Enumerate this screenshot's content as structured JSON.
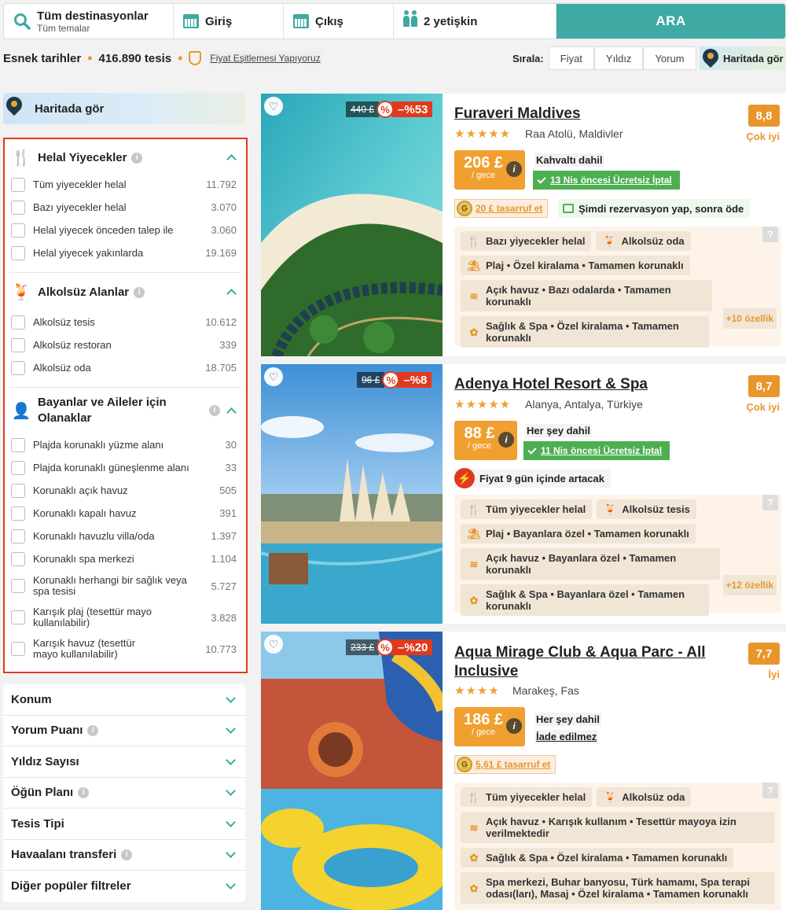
{
  "search": {
    "destination": "Tüm destinasyonlar",
    "theme": "Tüm temalar",
    "checkin": "Giriş",
    "checkout": "Çıkış",
    "guests": "2 yetişkin",
    "button": "ARA"
  },
  "info": {
    "flexible": "Esnek tarihler",
    "count": "416.890 tesis",
    "parity": "Fiyat Eşitlemesi Yapıyoruz"
  },
  "sort": {
    "label": "Sırala:",
    "options": [
      "Fiyat",
      "Yıldız",
      "Yorum"
    ],
    "map": "Haritada gör"
  },
  "sidebar": {
    "map": "Haritada gör",
    "sections": [
      {
        "title": "Helal Yiyecekler",
        "items": [
          {
            "label": "Tüm yiyecekler helal",
            "count": "11.792"
          },
          {
            "label": "Bazı yiyecekler helal",
            "count": "3.070"
          },
          {
            "label": "Helal yiyecek önceden talep ile",
            "count": "3.060"
          },
          {
            "label": "Helal yiyecek yakınlarda",
            "count": "19.169"
          }
        ]
      },
      {
        "title": "Alkolsüz Alanlar",
        "items": [
          {
            "label": "Alkolsüz tesis",
            "count": "10.612"
          },
          {
            "label": "Alkolsüz restoran",
            "count": "339"
          },
          {
            "label": "Alkolsüz oda",
            "count": "18.705"
          }
        ]
      },
      {
        "title": "Bayanlar ve Aileler için Olanaklar",
        "items": [
          {
            "label": "Plajda korunaklı yüzme alanı",
            "count": "30"
          },
          {
            "label": "Plajda korunaklı güneşlenme alanı",
            "count": "33"
          },
          {
            "label": "Korunaklı açık havuz",
            "count": "505"
          },
          {
            "label": "Korunaklı kapalı havuz",
            "count": "391"
          },
          {
            "label": "Korunaklı havuzlu villa/oda",
            "count": "1.397"
          },
          {
            "label": "Korunaklı spa merkezi",
            "count": "1.104"
          },
          {
            "label": "Korunaklı herhangi bir sağlık veya spa tesisi",
            "count": "5.727"
          },
          {
            "label": "Karışık plaj (tesettür mayo kullanılabilir)",
            "count": "3.828"
          },
          {
            "label": "Karışık havuz (tesettür mayo kullanılabilir)",
            "count": "10.773"
          }
        ]
      }
    ],
    "collapsed": [
      "Konum",
      "Yorum Puanı",
      "Yıldız Sayısı",
      "Öğün Planı",
      "Tesis Tipi",
      "Havaalanı transferi",
      "Diğer popüler filtreler"
    ]
  },
  "hotels": [
    {
      "name": "Furaveri Maldives",
      "stars": "★★★★★",
      "location": "Raa Atolü, Maldivler",
      "score": "8,8",
      "score_label": "Çok iyi",
      "old_price": "440 £",
      "discount": "–%53",
      "pct_icon": "%",
      "price": "206 £",
      "per": "/ gece",
      "board": "Kahvaltı dahil",
      "cancel": "13 Nis öncesi Ücretsiz İptal",
      "saving": "20 £ tasarruf et",
      "pay_later": "Şimdi rezervasyon yap, sonra öde",
      "features": [
        "Bazı yiyecekler helal",
        "Alkolsüz oda",
        "Plaj • Özel kiralama • Tamamen korunaklı",
        "Açık havuz • Bazı odalarda • Tamamen korunaklı",
        "Sağlık & Spa • Özel kiralama • Tamamen korunaklı"
      ],
      "more": "+10 özellik"
    },
    {
      "name": "Adenya Hotel Resort & Spa",
      "stars": "★★★★★",
      "location": "Alanya, Antalya, Türkiye",
      "score": "8,7",
      "score_label": "Çok iyi",
      "old_price": "96 £",
      "discount": "–%8",
      "pct_icon": "%",
      "price": "88 £",
      "per": "/ gece",
      "board": "Her şey dahil",
      "cancel": "11 Nis öncesi Ücretsiz İptal",
      "warning": "Fiyat 9 gün içinde artacak",
      "features": [
        "Tüm yiyecekler helal",
        "Alkolsüz tesis",
        "Plaj • Bayanlara özel • Tamamen korunaklı",
        "Açık havuz • Bayanlara özel • Tamamen korunaklı",
        "Sağlık & Spa • Bayanlara özel • Tamamen korunaklı"
      ],
      "more": "+12 özellik"
    },
    {
      "name": "Aqua Mirage Club & Aqua Parc - All Inclusive",
      "stars": "★★★★",
      "location": "Marakeş, Fas",
      "score": "7,7",
      "score_label": "İyi",
      "old_price": "233 £",
      "discount": "–%20",
      "pct_icon": "%",
      "price": "186 £",
      "per": "/ gece",
      "board": "Her şey dahil",
      "nonref": "İade edilmez",
      "saving": "5,61 £ tasarruf et",
      "features": [
        "Tüm yiyecekler helal",
        "Alkolsüz oda",
        "Açık havuz • Karışık kullanım • Tesettür mayoya izin verilmektedir",
        "Sağlık & Spa • Özel kiralama • Tamamen korunaklı",
        "Spa merkezi, Buhar banyosu, Türk hamamı, Spa terapi odası(ları), Masaj • Özel kiralama • Tamamen korunaklı"
      ]
    }
  ],
  "colors": {
    "teal": "#3fa9a3",
    "orange": "#e8962b",
    "red": "#e03a1e",
    "green": "#4caf50"
  }
}
